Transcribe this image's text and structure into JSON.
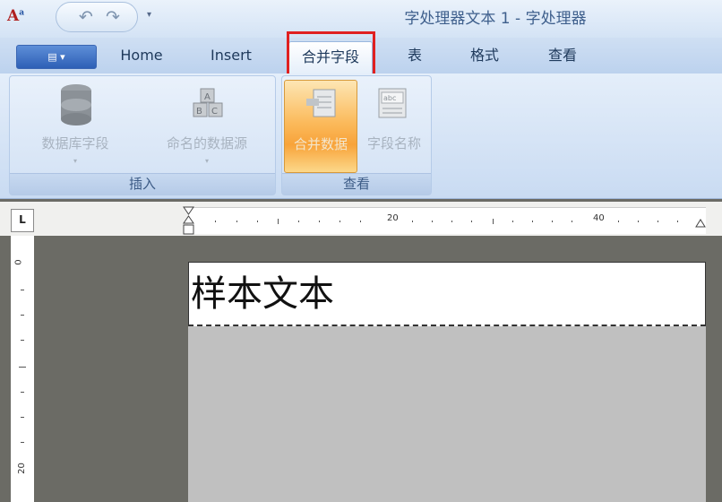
{
  "window": {
    "title": "字处理器文本 1 - 字处理器",
    "qat_dropdown": "▾"
  },
  "tabs": [
    {
      "label": "Home"
    },
    {
      "label": "Insert"
    },
    {
      "label": "合并字段"
    },
    {
      "label": "表"
    },
    {
      "label": "格式"
    },
    {
      "label": "查看"
    }
  ],
  "ribbon": {
    "insert_group": {
      "label": "插入",
      "buttons": [
        {
          "label": "数据库字段"
        },
        {
          "label": "命名的数据源"
        }
      ]
    },
    "view_group": {
      "label": "查看",
      "buttons": [
        {
          "label": "合并数据"
        },
        {
          "label": "字段名称"
        }
      ]
    }
  },
  "ruler": {
    "numbers": [
      "20",
      "40"
    ],
    "vertical_numbers": [
      "0",
      "20"
    ]
  },
  "document": {
    "header_text": "样本文本"
  }
}
